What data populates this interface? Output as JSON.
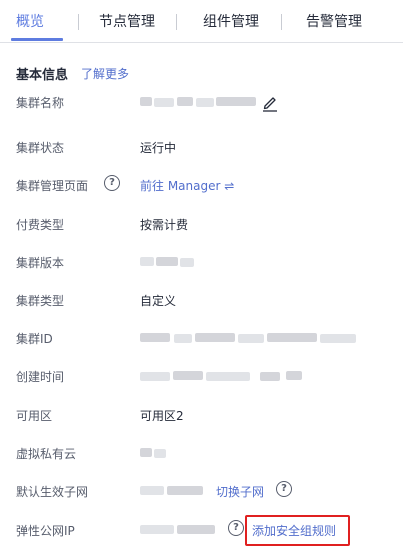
{
  "tabs": [
    {
      "label": "概览",
      "active": true
    },
    {
      "label": "节点管理",
      "active": false
    },
    {
      "label": "组件管理",
      "active": false
    },
    {
      "label": "告警管理",
      "active": false
    }
  ],
  "basic_info": {
    "title": "基本信息",
    "learn_more": "了解更多"
  },
  "rows": {
    "cluster_name": {
      "label": "集群名称"
    },
    "cluster_status": {
      "label": "集群状态",
      "value": "运行中"
    },
    "cluster_manage_page": {
      "label": "集群管理页面",
      "value": "前往 Manager ⇌"
    },
    "billing_type": {
      "label": "付费类型",
      "value": "按需计费"
    },
    "cluster_version": {
      "label": "集群版本"
    },
    "cluster_type": {
      "label": "集群类型",
      "value": "自定义"
    },
    "cluster_id": {
      "label": "集群ID"
    },
    "create_time": {
      "label": "创建时间"
    },
    "az": {
      "label": "可用区",
      "value": "可用区2"
    },
    "vpc": {
      "label": "虚拟私有云"
    },
    "default_subnet": {
      "label": "默认生效子网",
      "switch_link": "切换子网"
    },
    "eip": {
      "label": "弹性公网IP",
      "add_rule_link": "添加安全组规则"
    }
  },
  "icons": {
    "help": "?"
  },
  "colors": {
    "accent": "#5e7ce0",
    "link": "#526ecc",
    "highlight_box": "#e02020"
  }
}
